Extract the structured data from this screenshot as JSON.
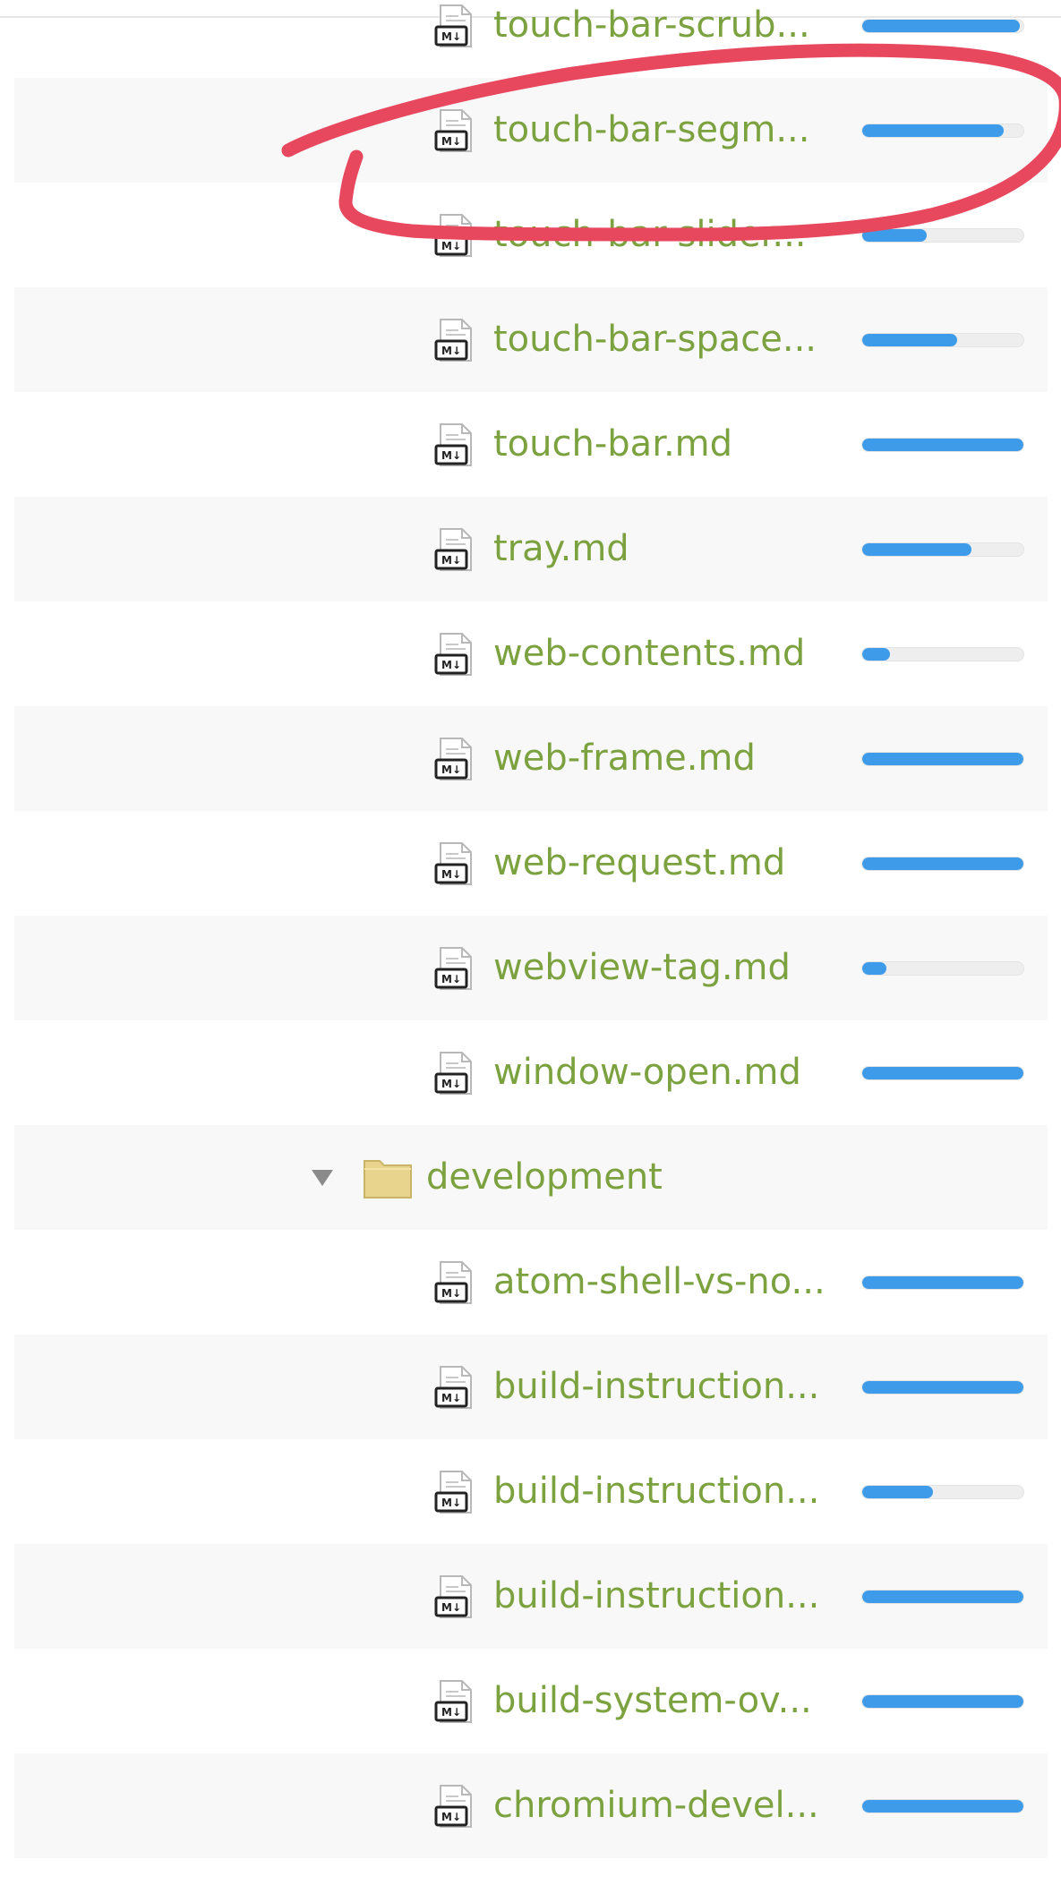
{
  "accent_color": "#3d9be9",
  "label_color": "#7ba23f",
  "annotation_color": "#e8485e",
  "rows": [
    {
      "type": "file",
      "icon": "markdown-file-icon",
      "label": "touch-bar-scrub...",
      "progress": 0.98
    },
    {
      "type": "file",
      "icon": "markdown-file-icon",
      "label": "touch-bar-segm...",
      "progress": 0.88
    },
    {
      "type": "file",
      "icon": "markdown-file-icon",
      "label": "touch-bar-slider...",
      "progress": 0.4
    },
    {
      "type": "file",
      "icon": "markdown-file-icon",
      "label": "touch-bar-space...",
      "progress": 0.59
    },
    {
      "type": "file",
      "icon": "markdown-file-icon",
      "label": "touch-bar.md",
      "progress": 1.0
    },
    {
      "type": "file",
      "icon": "markdown-file-icon",
      "label": "tray.md",
      "progress": 0.68
    },
    {
      "type": "file",
      "icon": "markdown-file-icon",
      "label": "web-contents.md",
      "progress": 0.17
    },
    {
      "type": "file",
      "icon": "markdown-file-icon",
      "label": "web-frame.md",
      "progress": 1.0
    },
    {
      "type": "file",
      "icon": "markdown-file-icon",
      "label": "web-request.md",
      "progress": 1.0
    },
    {
      "type": "file",
      "icon": "markdown-file-icon",
      "label": "webview-tag.md",
      "progress": 0.15
    },
    {
      "type": "file",
      "icon": "markdown-file-icon",
      "label": "window-open.md",
      "progress": 1.0
    },
    {
      "type": "folder",
      "icon": "folder-icon",
      "toggle": "expanded-triangle-icon",
      "label": "development"
    },
    {
      "type": "file",
      "icon": "markdown-file-icon",
      "label": "atom-shell-vs-no...",
      "progress": 1.0
    },
    {
      "type": "file",
      "icon": "markdown-file-icon",
      "label": "build-instruction...",
      "progress": 1.0
    },
    {
      "type": "file",
      "icon": "markdown-file-icon",
      "label": "build-instruction...",
      "progress": 0.44
    },
    {
      "type": "file",
      "icon": "markdown-file-icon",
      "label": "build-instruction...",
      "progress": 1.0
    },
    {
      "type": "file",
      "icon": "markdown-file-icon",
      "label": "build-system-ov...",
      "progress": 1.0
    },
    {
      "type": "file",
      "icon": "markdown-file-icon",
      "label": "chromium-devel...",
      "progress": 1.0
    }
  ]
}
